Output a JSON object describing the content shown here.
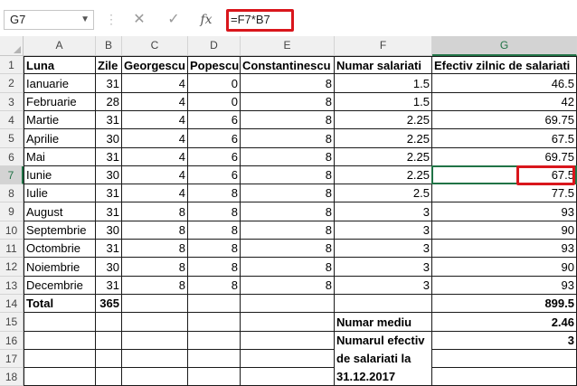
{
  "formula_bar": {
    "name_box": "G7",
    "cancel_icon": "✕",
    "enter_icon": "✓",
    "function_icon": "fx",
    "formula": "=F7*B7"
  },
  "columns": [
    "A",
    "B",
    "C",
    "D",
    "E",
    "F",
    "G"
  ],
  "selected_column": "G",
  "rows": [
    "1",
    "2",
    "3",
    "4",
    "5",
    "6",
    "7",
    "8",
    "9",
    "10",
    "11",
    "12",
    "13",
    "14",
    "15",
    "16",
    "17",
    "18"
  ],
  "selected_row": "7",
  "selected_cell": "G7",
  "highlight_color": "#d9161c",
  "selection_color": "#217346",
  "table": {
    "headers": [
      "Luna",
      "Zile",
      "Georgescu",
      "Popescu",
      "Constantinescu",
      "Numar salariati",
      "Efectiv zilnic de salariati"
    ],
    "data": [
      [
        "Ianuarie",
        "31",
        "4",
        "0",
        "8",
        "1.5",
        "46.5"
      ],
      [
        "Februarie",
        "28",
        "4",
        "0",
        "8",
        "1.5",
        "42"
      ],
      [
        "Martie",
        "31",
        "4",
        "6",
        "8",
        "2.25",
        "69.75"
      ],
      [
        "Aprilie",
        "30",
        "4",
        "6",
        "8",
        "2.25",
        "67.5"
      ],
      [
        "Mai",
        "31",
        "4",
        "6",
        "8",
        "2.25",
        "69.75"
      ],
      [
        "Iunie",
        "30",
        "4",
        "6",
        "8",
        "2.25",
        "67.5"
      ],
      [
        "Iulie",
        "31",
        "4",
        "8",
        "8",
        "2.5",
        "77.5"
      ],
      [
        "August",
        "31",
        "8",
        "8",
        "8",
        "3",
        "93"
      ],
      [
        "Septembrie",
        "30",
        "8",
        "8",
        "8",
        "3",
        "90"
      ],
      [
        "Octombrie",
        "31",
        "8",
        "8",
        "8",
        "3",
        "93"
      ],
      [
        "Noiembrie",
        "30",
        "8",
        "8",
        "8",
        "3",
        "90"
      ],
      [
        "Decembrie",
        "31",
        "8",
        "8",
        "8",
        "3",
        "93"
      ]
    ],
    "total": {
      "label": "Total",
      "days": "365",
      "value": "899.5"
    },
    "summary": [
      {
        "label": "Numar mediu",
        "value": "2.46"
      },
      {
        "label": "Numarul efectiv",
        "value": "3"
      },
      {
        "label": "de salariati la",
        "value": ""
      },
      {
        "label": "31.12.2017",
        "value": ""
      }
    ]
  }
}
